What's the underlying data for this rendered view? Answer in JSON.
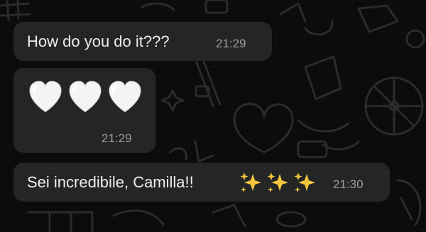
{
  "chat": {
    "messages": [
      {
        "text": "How do you do it???",
        "time": "21:29"
      },
      {
        "emoji": "white-heart-icon",
        "emoji_count": 3,
        "time": "21:29"
      },
      {
        "text": "Sei incredibile, Camilla!!",
        "emoji": "sparkles-icon",
        "emoji_count": 3,
        "time": "21:30"
      }
    ]
  },
  "colors": {
    "background": "#0c0c0c",
    "bubble": "#242626",
    "text": "#ededed",
    "timestamp": "#9a9d9e",
    "doodle": "#2b2b2b",
    "sparkle": "#f5c63c"
  }
}
